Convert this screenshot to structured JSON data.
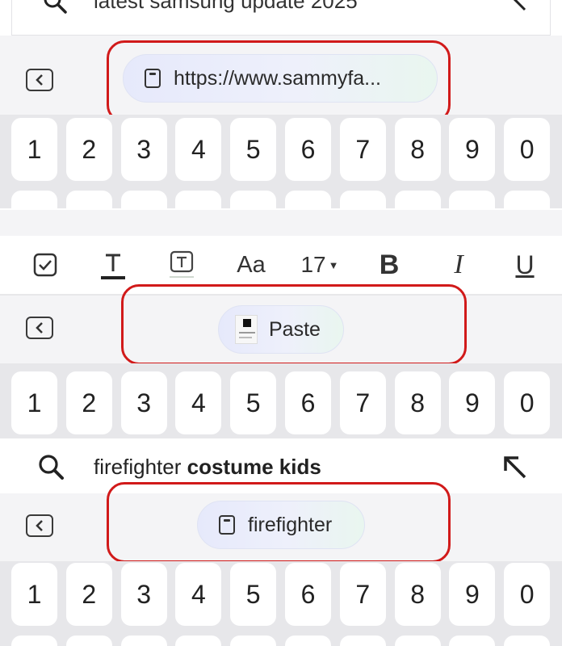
{
  "panel1": {
    "search_text": "latest samsung update 2025",
    "clipboard_chip": "https://www.sammyfa...",
    "number_keys": [
      "1",
      "2",
      "3",
      "4",
      "5",
      "6",
      "7",
      "8",
      "9",
      "0"
    ]
  },
  "panel2": {
    "toolbar": {
      "font_size": "17",
      "font_size_unit_label": "Aa",
      "bold": "B",
      "italic": "I",
      "underline": "U"
    },
    "clipboard_chip": "Paste",
    "number_keys": [
      "1",
      "2",
      "3",
      "4",
      "5",
      "6",
      "7",
      "8",
      "9",
      "0"
    ]
  },
  "panel3": {
    "search_prefix": "firefighter",
    "search_suffix": "costume kids",
    "clipboard_chip": "firefighter",
    "number_keys": [
      "1",
      "2",
      "3",
      "4",
      "5",
      "6",
      "7",
      "8",
      "9",
      "0"
    ]
  },
  "colors": {
    "highlight": "#d11a1a",
    "keyboard_bg": "#e7e7ea",
    "key_bg": "#ffffff",
    "chip_gradient_start": "#e6e9fb",
    "chip_gradient_end": "#e9f6ef"
  },
  "icons": [
    "search-icon",
    "back-icon",
    "clipboard-icon",
    "checkbox-icon",
    "text-color-icon",
    "text-highlight-icon",
    "arrow-up-left-icon"
  ]
}
